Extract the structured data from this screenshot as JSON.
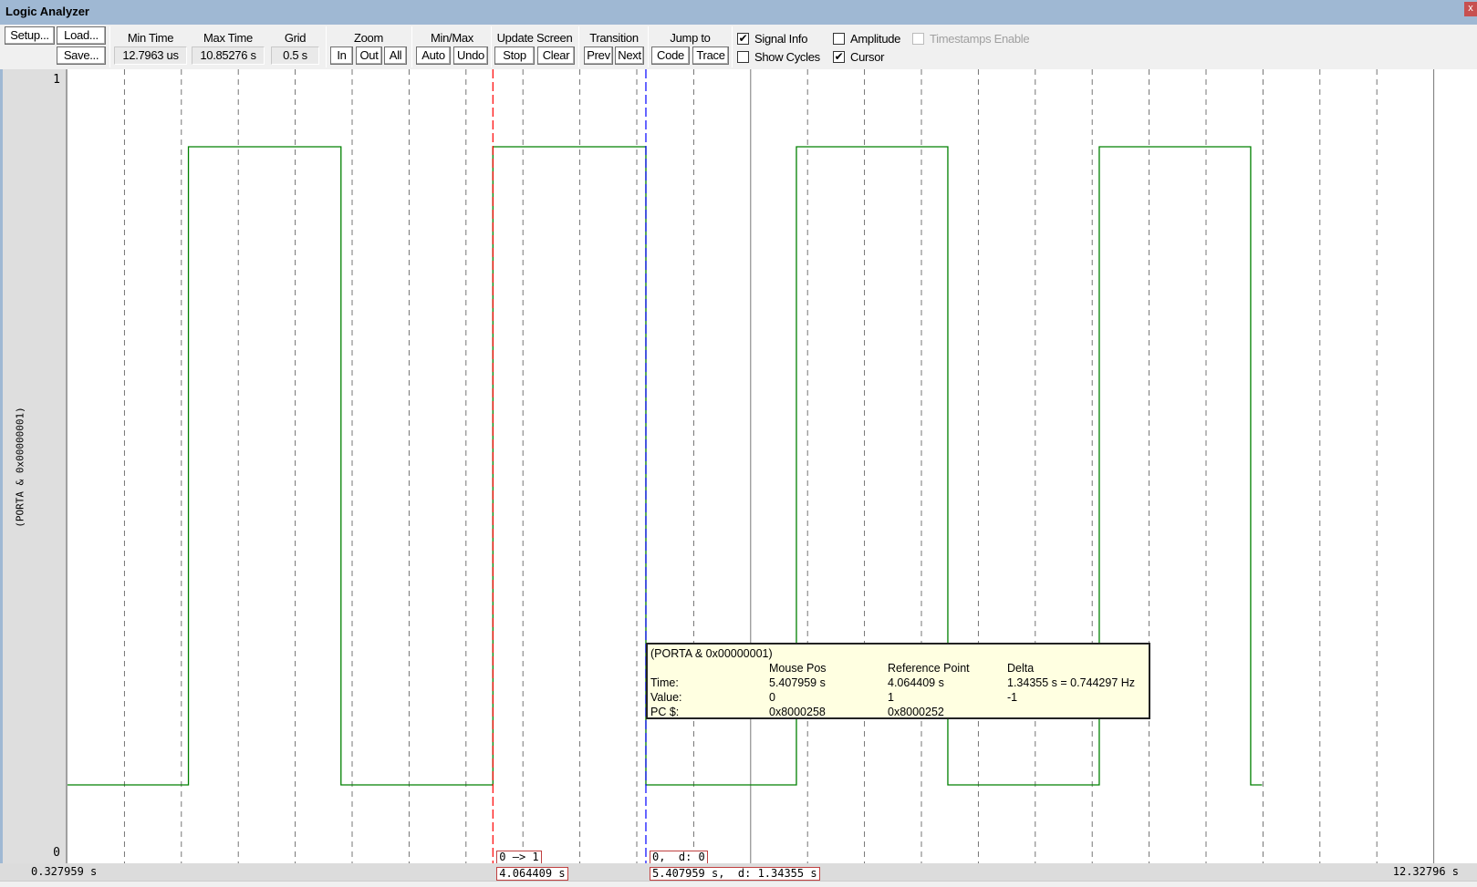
{
  "window": {
    "title": "Logic Analyzer",
    "close_label": "x"
  },
  "toolbar": {
    "setup": "Setup...",
    "load": "Load...",
    "save": "Save...",
    "min_time_label": "Min Time",
    "min_time": "12.7963 us",
    "max_time_label": "Max Time",
    "max_time": "10.85276 s",
    "grid_label": "Grid",
    "grid": "0.5 s",
    "zoom_label": "Zoom",
    "zoom_in": "In",
    "zoom_out": "Out",
    "zoom_all": "All",
    "minmax_label": "Min/Max",
    "auto": "Auto",
    "undo": "Undo",
    "update_label": "Update Screen",
    "stop": "Stop",
    "clear": "Clear",
    "transition_label": "Transition",
    "prev": "Prev",
    "next": "Next",
    "jump_label": "Jump to",
    "code": "Code",
    "trace": "Trace",
    "checkboxes": [
      {
        "label": "Signal Info",
        "checked": true,
        "enabled": true
      },
      {
        "label": "Show Cycles",
        "checked": false,
        "enabled": true
      },
      {
        "label": "Amplitude",
        "checked": false,
        "enabled": true
      },
      {
        "label": "Cursor",
        "checked": true,
        "enabled": true
      },
      {
        "label": "Timestamps Enable",
        "checked": false,
        "enabled": false
      }
    ]
  },
  "signal": {
    "name": "(PORTA & 0x00000001)",
    "y_max": "1",
    "y_min": "0",
    "color": "#008000"
  },
  "timeline": {
    "start": "0.327959 s",
    "end": "12.32796 s"
  },
  "chart_data": {
    "type": "line",
    "step": true,
    "xlim": [
      0.327959,
      12.32796
    ],
    "ylim": [
      0,
      1
    ],
    "grid_s": 0.5,
    "grid": true,
    "x": [
      0.327959,
      1.39,
      2.73,
      4.064409,
      5.407959,
      6.73,
      8.06,
      9.39,
      10.72,
      10.82
    ],
    "y": [
      0,
      1,
      0,
      1,
      0,
      1,
      0,
      1,
      0,
      0
    ]
  },
  "cursors": {
    "reference": {
      "time": 4.064409,
      "color": "#ff0000",
      "value_label": "0 —> 1",
      "time_label": "4.064409 s"
    },
    "mouse": {
      "time": 5.407959,
      "color": "#0000ff",
      "value_label": "0,  d: 0",
      "time_label": "5.407959 s,  d: 1.34355 s"
    }
  },
  "tooltip": {
    "title": "(PORTA & 0x00000001)",
    "headers": [
      "",
      "Mouse Pos",
      "Reference Point",
      "Delta"
    ],
    "rows": [
      [
        "Time:",
        "5.407959 s",
        "4.064409 s",
        "1.34355 s = 0.744297 Hz"
      ],
      [
        "Value:",
        "0",
        "1",
        "-1"
      ],
      [
        "PC $:",
        "0x8000258",
        "0x8000252",
        ""
      ]
    ]
  }
}
